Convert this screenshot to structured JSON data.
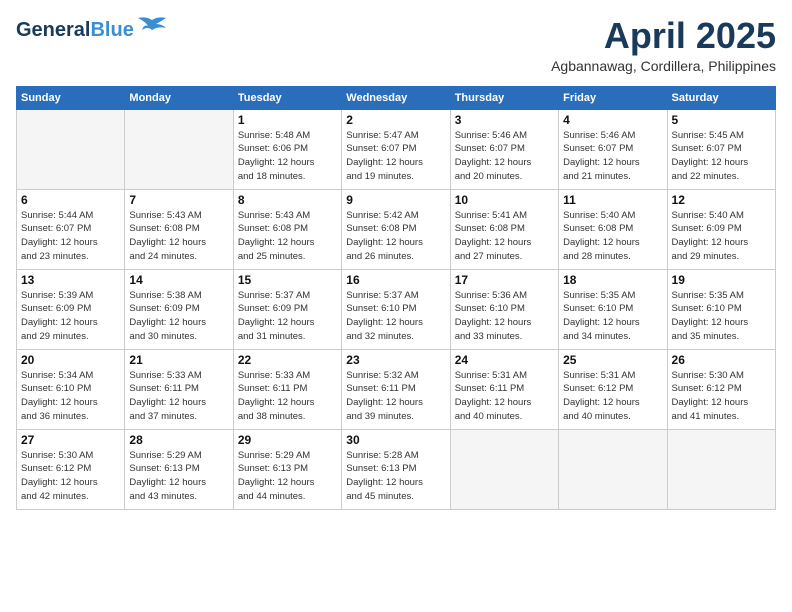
{
  "header": {
    "logo_line1": "General",
    "logo_line2": "Blue",
    "month": "April 2025",
    "location": "Agbannawag, Cordillera, Philippines"
  },
  "days_of_week": [
    "Sunday",
    "Monday",
    "Tuesday",
    "Wednesday",
    "Thursday",
    "Friday",
    "Saturday"
  ],
  "weeks": [
    [
      {
        "day": "",
        "info": ""
      },
      {
        "day": "",
        "info": ""
      },
      {
        "day": "1",
        "info": "Sunrise: 5:48 AM\nSunset: 6:06 PM\nDaylight: 12 hours\nand 18 minutes."
      },
      {
        "day": "2",
        "info": "Sunrise: 5:47 AM\nSunset: 6:07 PM\nDaylight: 12 hours\nand 19 minutes."
      },
      {
        "day": "3",
        "info": "Sunrise: 5:46 AM\nSunset: 6:07 PM\nDaylight: 12 hours\nand 20 minutes."
      },
      {
        "day": "4",
        "info": "Sunrise: 5:46 AM\nSunset: 6:07 PM\nDaylight: 12 hours\nand 21 minutes."
      },
      {
        "day": "5",
        "info": "Sunrise: 5:45 AM\nSunset: 6:07 PM\nDaylight: 12 hours\nand 22 minutes."
      }
    ],
    [
      {
        "day": "6",
        "info": "Sunrise: 5:44 AM\nSunset: 6:07 PM\nDaylight: 12 hours\nand 23 minutes."
      },
      {
        "day": "7",
        "info": "Sunrise: 5:43 AM\nSunset: 6:08 PM\nDaylight: 12 hours\nand 24 minutes."
      },
      {
        "day": "8",
        "info": "Sunrise: 5:43 AM\nSunset: 6:08 PM\nDaylight: 12 hours\nand 25 minutes."
      },
      {
        "day": "9",
        "info": "Sunrise: 5:42 AM\nSunset: 6:08 PM\nDaylight: 12 hours\nand 26 minutes."
      },
      {
        "day": "10",
        "info": "Sunrise: 5:41 AM\nSunset: 6:08 PM\nDaylight: 12 hours\nand 27 minutes."
      },
      {
        "day": "11",
        "info": "Sunrise: 5:40 AM\nSunset: 6:08 PM\nDaylight: 12 hours\nand 28 minutes."
      },
      {
        "day": "12",
        "info": "Sunrise: 5:40 AM\nSunset: 6:09 PM\nDaylight: 12 hours\nand 29 minutes."
      }
    ],
    [
      {
        "day": "13",
        "info": "Sunrise: 5:39 AM\nSunset: 6:09 PM\nDaylight: 12 hours\nand 29 minutes."
      },
      {
        "day": "14",
        "info": "Sunrise: 5:38 AM\nSunset: 6:09 PM\nDaylight: 12 hours\nand 30 minutes."
      },
      {
        "day": "15",
        "info": "Sunrise: 5:37 AM\nSunset: 6:09 PM\nDaylight: 12 hours\nand 31 minutes."
      },
      {
        "day": "16",
        "info": "Sunrise: 5:37 AM\nSunset: 6:10 PM\nDaylight: 12 hours\nand 32 minutes."
      },
      {
        "day": "17",
        "info": "Sunrise: 5:36 AM\nSunset: 6:10 PM\nDaylight: 12 hours\nand 33 minutes."
      },
      {
        "day": "18",
        "info": "Sunrise: 5:35 AM\nSunset: 6:10 PM\nDaylight: 12 hours\nand 34 minutes."
      },
      {
        "day": "19",
        "info": "Sunrise: 5:35 AM\nSunset: 6:10 PM\nDaylight: 12 hours\nand 35 minutes."
      }
    ],
    [
      {
        "day": "20",
        "info": "Sunrise: 5:34 AM\nSunset: 6:10 PM\nDaylight: 12 hours\nand 36 minutes."
      },
      {
        "day": "21",
        "info": "Sunrise: 5:33 AM\nSunset: 6:11 PM\nDaylight: 12 hours\nand 37 minutes."
      },
      {
        "day": "22",
        "info": "Sunrise: 5:33 AM\nSunset: 6:11 PM\nDaylight: 12 hours\nand 38 minutes."
      },
      {
        "day": "23",
        "info": "Sunrise: 5:32 AM\nSunset: 6:11 PM\nDaylight: 12 hours\nand 39 minutes."
      },
      {
        "day": "24",
        "info": "Sunrise: 5:31 AM\nSunset: 6:11 PM\nDaylight: 12 hours\nand 40 minutes."
      },
      {
        "day": "25",
        "info": "Sunrise: 5:31 AM\nSunset: 6:12 PM\nDaylight: 12 hours\nand 40 minutes."
      },
      {
        "day": "26",
        "info": "Sunrise: 5:30 AM\nSunset: 6:12 PM\nDaylight: 12 hours\nand 41 minutes."
      }
    ],
    [
      {
        "day": "27",
        "info": "Sunrise: 5:30 AM\nSunset: 6:12 PM\nDaylight: 12 hours\nand 42 minutes."
      },
      {
        "day": "28",
        "info": "Sunrise: 5:29 AM\nSunset: 6:13 PM\nDaylight: 12 hours\nand 43 minutes."
      },
      {
        "day": "29",
        "info": "Sunrise: 5:29 AM\nSunset: 6:13 PM\nDaylight: 12 hours\nand 44 minutes."
      },
      {
        "day": "30",
        "info": "Sunrise: 5:28 AM\nSunset: 6:13 PM\nDaylight: 12 hours\nand 45 minutes."
      },
      {
        "day": "",
        "info": ""
      },
      {
        "day": "",
        "info": ""
      },
      {
        "day": "",
        "info": ""
      }
    ]
  ]
}
